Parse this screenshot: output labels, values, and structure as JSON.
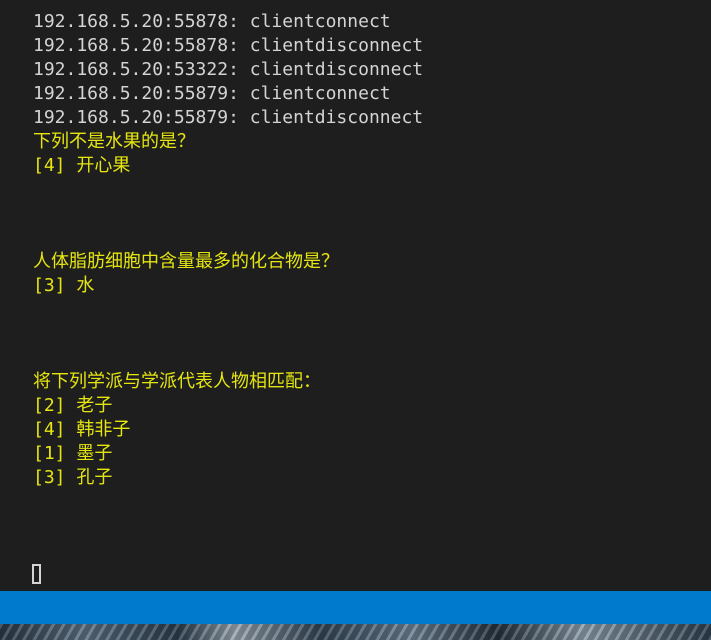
{
  "log_lines": [
    "192.168.5.20:55878: clientconnect",
    "192.168.5.20:55878: clientdisconnect",
    "192.168.5.20:53322: clientdisconnect",
    "192.168.5.20:55879: clientconnect",
    "192.168.5.20:55879: clientdisconnect"
  ],
  "questions": [
    {
      "prompt": "下列不是水果的是？",
      "answers": [
        "[4] 开心果"
      ]
    },
    {
      "prompt": "人体脂肪细胞中含量最多的化合物是？",
      "answers": [
        "[3] 水"
      ]
    },
    {
      "prompt": "将下列学派与学派代表人物相匹配：",
      "answers": [
        "[2] 老子",
        "[4] 韩非子",
        "[1] 墨子",
        "[3] 孔子"
      ]
    }
  ],
  "colors": {
    "terminal_bg": "#1e1e1e",
    "log_text": "#d4d4d4",
    "question_text": "#e5e510",
    "status_bar": "#007acc"
  }
}
